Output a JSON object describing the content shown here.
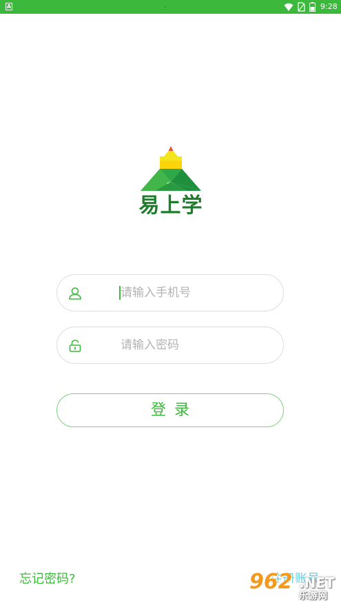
{
  "status_bar": {
    "time": "9:28",
    "left_icon": "A",
    "background_color": "#3cb93c",
    "battery_icon": "battery-icon",
    "wifi_icon": "wifi-icon",
    "sim_icon": "no-sim-icon"
  },
  "logo": {
    "app_name": "易上学",
    "icon": "pencil-mountain-logo-icon",
    "brand_color": "#1e7d2a"
  },
  "login_form": {
    "phone_placeholder": "请输入手机号",
    "phone_icon": "user-icon",
    "password_placeholder": "请输入密码",
    "password_icon": "lock-icon",
    "login_label": "登录",
    "accent_color": "#3cb93c"
  },
  "footer": {
    "forgot_password": "忘记密码?",
    "register": "注册账号"
  },
  "watermark": {
    "main": "962",
    "net": ".NET",
    "sub": "乐游网"
  }
}
